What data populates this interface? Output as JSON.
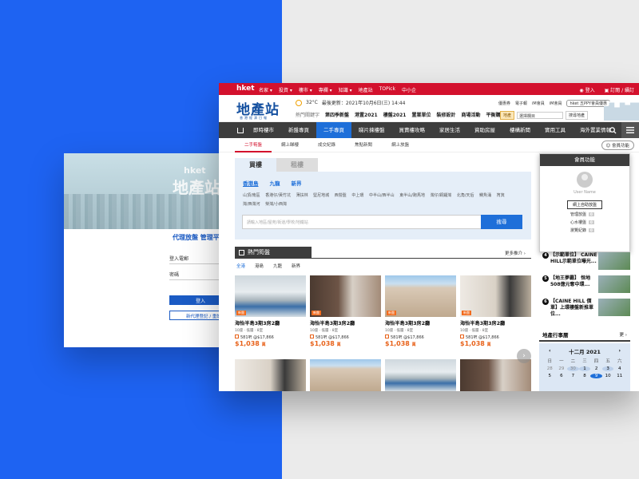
{
  "login": {
    "logo_small": "hket",
    "logo_main": "地產站",
    "title": "代理放盤 管理平台",
    "user_label": "登入電郵",
    "pass_label": "密碼",
    "login_button": "登入",
    "register_button": "新代理登記 / 重設密碼"
  },
  "topbar": {
    "brand": "hket",
    "nav": [
      "名家 ▾",
      "投資 ▾",
      "樓市 ▾",
      "專欄 ▾",
      "知識 ▾",
      "地產站",
      "TOPick",
      "中小企"
    ],
    "login": "登入",
    "subscribe": "訂閱 / 續訂"
  },
  "header": {
    "logo": "地產站",
    "logo_sub": "香港經濟日報",
    "temperature": "32°C",
    "updated": "最後更新：2021年10月6日(三) 14:44",
    "hot_label": "熱門關鍵字",
    "hot_links": [
      "第四季新盤",
      "港置2021",
      "樓盤2021",
      "置業單位",
      "裝修設計",
      "商場活動",
      "平衡購物節"
    ],
    "tools": [
      "優惠券",
      "電子報",
      "iM會員",
      "iM會員"
    ],
    "edition_button": "hket 五PPY會員優惠",
    "search_tag": "地產",
    "search_select": "選擇欄目",
    "search_button": "搜尋地產"
  },
  "mainnav": [
    "即時樓市",
    "新盤專頁",
    "二手專頁",
    "睇片揀樓盤",
    "買賣樓攻略",
    "家居生活",
    "資助房屋",
    "樓構新聞",
    "實用工具",
    "海外置業情報"
  ],
  "mainnav_active": 2,
  "subnav": [
    "二手筍盤",
    "網上睇樓",
    "成交紀錄",
    "焦點新聞",
    "網上放盤"
  ],
  "member_button": "會員功能",
  "search": {
    "tab_buy": "買樓",
    "tab_rent": "租樓",
    "regions": [
      "香港島",
      "九龍",
      "新界"
    ],
    "districts": [
      "山頂/南區",
      "香港仔/黃竹坑",
      "薄扶林",
      "堅尼地城",
      "西營盤",
      "中上環",
      "中半山/西半山",
      "東半山/跑馬地",
      "灣仔/銅鑼灣",
      "北角/天后",
      "鰂魚涌",
      "筲箕灣/西灣河",
      "柴灣/小西灣"
    ],
    "keyword_placeholder": "請輸入地區/屋苑/街道/學校/地鐵站",
    "search_button": "搜尋"
  },
  "hot": {
    "title": "熱門筍盤",
    "more": "更多推介",
    "tabs": [
      "全港",
      "港島",
      "九龍",
      "新界"
    ],
    "cards": [
      {
        "name": "海怡半島3期3房2廳",
        "meta": "10座 · 低層 · 8室",
        "price_psf": "581呎 @$17,866",
        "price": "$1,038",
        "unit": "萬",
        "badge": "新盤"
      },
      {
        "name": "海怡半島3期3房2廳",
        "meta": "10座 · 低層 · 8室",
        "price_psf": "581呎 @$17,866",
        "price": "$1,038",
        "unit": "萬",
        "badge": "新盤"
      },
      {
        "name": "海怡半島3期3房2廳",
        "meta": "10座 · 低層 · 8室",
        "price_psf": "581呎 @$17,866",
        "price": "$1,038",
        "unit": "萬",
        "badge": "新盤"
      },
      {
        "name": "海怡半島3期3房2廳",
        "meta": "10座 · 低層 · 8室",
        "price_psf": "581呎 @$17,866",
        "price": "$1,038",
        "unit": "萬",
        "badge": "新盤"
      }
    ]
  },
  "member_panel": {
    "title": "會員功能",
    "user": "User Name",
    "account_button": "網上自助放盤",
    "items": [
      {
        "label": "管理放盤",
        "count": "0"
      },
      {
        "label": "心水樓盤",
        "count": "0"
      },
      {
        "label": "瀏覽紀錄",
        "count": "0"
      }
    ]
  },
  "news": [
    {
      "n": "4",
      "text": "【示範單位】 CAINE HILL示範單位曝光..."
    },
    {
      "n": "5",
      "text": "【地王夢霸】 恒地508億元奪中環..."
    },
    {
      "n": "6",
      "text": "【CAINE HILL 價單】上環樓盤新推單位..."
    }
  ],
  "calendar": {
    "title": "地產行事曆",
    "more": "更多",
    "month": "十二月 2021",
    "weekdays": [
      "日",
      "一",
      "二",
      "三",
      "四",
      "五",
      "六"
    ],
    "days": [
      "28",
      "29",
      "30",
      "1",
      "2",
      "3",
      "4",
      "5",
      "6",
      "7",
      "8",
      "9",
      "10",
      "11"
    ],
    "current": "9"
  },
  "colors": {
    "brand_red": "#d3112d",
    "accent_blue": "#1e6fd9",
    "price_orange": "#e8621a",
    "nav_dark": "#3d3d3d"
  }
}
